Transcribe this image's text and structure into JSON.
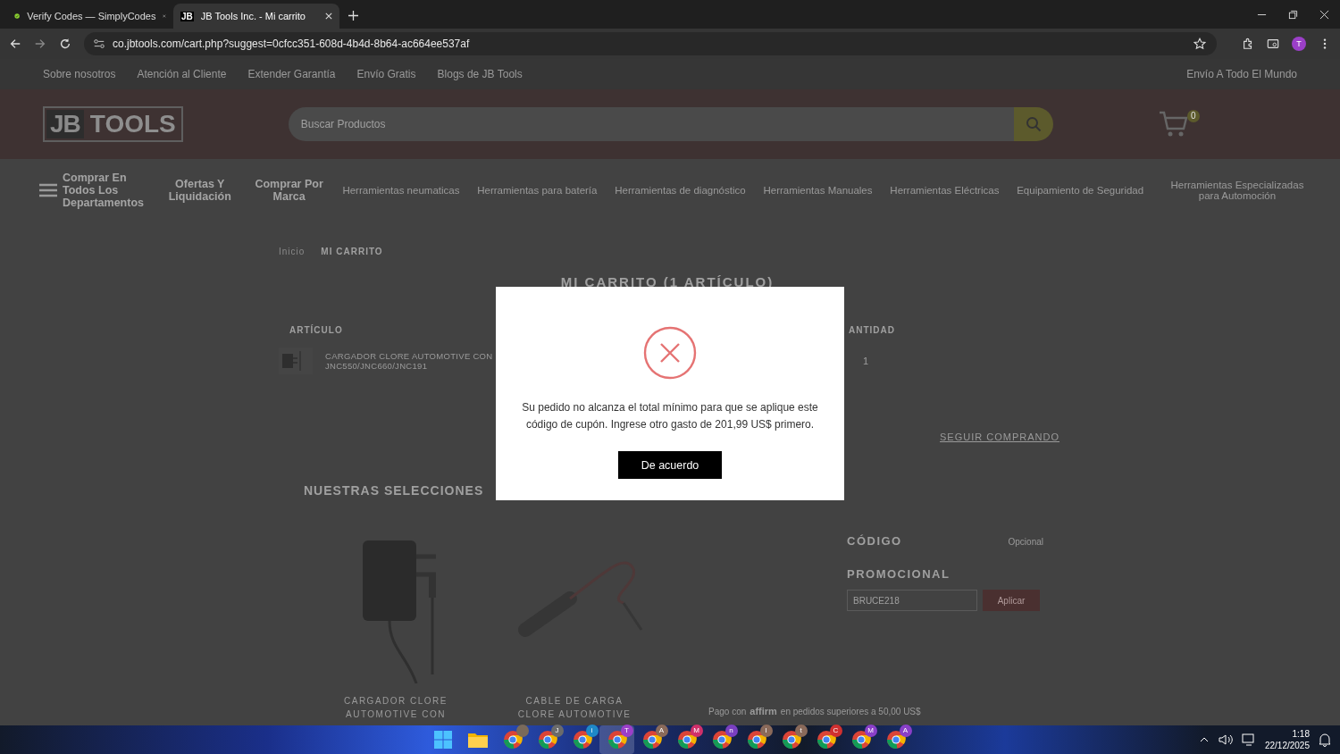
{
  "browser": {
    "tabs": [
      {
        "title": "Verify Codes — SimplyCodes",
        "selected": false,
        "kind": "check"
      },
      {
        "title": "JB Tools Inc. - Mi carrito",
        "selected": true,
        "kind": "text",
        "favicon": "JB"
      }
    ],
    "url": "co.jbtools.com/cart.php?suggest=0cfcc351-608d-4b4d-8b64-ac664ee537af",
    "profile": "T"
  },
  "site": {
    "top_links": [
      "Sobre nosotros",
      "Atención al Cliente",
      "Extender Garantía",
      "Envío Gratis",
      "Blogs de JB Tools"
    ],
    "top_right": "Envío A Todo El Mundo",
    "logo": {
      "left": "JB",
      "right": "TOOLS"
    },
    "search": {
      "placeholder": "Buscar Productos"
    },
    "cart_count": "0",
    "nav": [
      {
        "label": "Comprar En Todos Los Departamentos",
        "kind": "menu"
      },
      {
        "label": "Ofertas Y Liquidación",
        "kind": "bold"
      },
      {
        "label": "Comprar Por Marca",
        "kind": "bold"
      },
      {
        "label": "Herramientas neumaticas",
        "kind": "plain"
      },
      {
        "label": "Herramientas para batería",
        "kind": "plain"
      },
      {
        "label": "Herramientas de diagnóstico",
        "kind": "plain"
      },
      {
        "label": "Herramientas Manuales",
        "kind": "plain"
      },
      {
        "label": "Herramientas Eléctricas",
        "kind": "plain"
      },
      {
        "label": "Equipamiento de Seguridad",
        "kind": "plain"
      },
      {
        "label": "Herramientas Especializadas para Automoción",
        "kind": "plain"
      }
    ],
    "breadcrumb": [
      "Inicio",
      "MI CARRITO"
    ],
    "cart": {
      "title": "MI CARRITO (1 ARTÍCULO)",
      "columns": [
        "ARTÍCULO",
        "ANTIDAD"
      ],
      "item": {
        "name": [
          "CARGADOR CLORE AUTOMOTIVE CON",
          "JNC550/JNC660/JNC191"
        ],
        "quantity": "1"
      },
      "continue": "SEGUIR COMPRANDO"
    },
    "selections": {
      "title": "NUESTRAS SELECCIONES",
      "products": [
        {
          "name": [
            "CARGADOR CLORE",
            "AUTOMOTIVE CON"
          ],
          "kind": "charger"
        },
        {
          "name": [
            "CABLE DE CARGA",
            "CLORE AUTOMOTIVE"
          ],
          "kind": "cable"
        }
      ]
    },
    "promo": {
      "label": "CÓDIGO",
      "optional": "Opcional",
      "label2": "PROMOCIONAL",
      "value": "BRUCE218",
      "button": "Aplicar"
    },
    "affirm": {
      "prefix": "Pago con",
      "logo": "affirm",
      "suffix": "en pedidos superiores a 50,00 US$"
    }
  },
  "dialog": {
    "message": "Su pedido no alcanza el total mínimo para que se aplique este código de cupón. Ingrese otro gasto de 201,99 US$ primero.",
    "button": "De acuerdo"
  },
  "taskbar": {
    "apps": [
      {
        "kind": "start",
        "selected": false
      },
      {
        "kind": "folder",
        "selected": false
      },
      {
        "kind": "browser",
        "color": "#7a6a5a",
        "selected": false
      },
      {
        "kind": "browser",
        "badge": "J",
        "color": "#6b6b6b",
        "selected": false
      },
      {
        "kind": "browser",
        "badge": "i",
        "color": "#1e88c8",
        "selected": false
      },
      {
        "kind": "browser",
        "badge": "T",
        "color": "#9b3fc8",
        "selected": true
      },
      {
        "kind": "browser",
        "badge": "A",
        "color": "#8a6a5a",
        "selected": false
      },
      {
        "kind": "browser",
        "badge": "M",
        "color": "#d0306a",
        "selected": false
      },
      {
        "kind": "browser",
        "badge": "n",
        "color": "#7a3fc0",
        "selected": false
      },
      {
        "kind": "browser",
        "badge": "I",
        "color": "#8a6a5a",
        "selected": false
      },
      {
        "kind": "browser",
        "badge": "t",
        "color": "#8a6a5a",
        "selected": false
      },
      {
        "kind": "browser",
        "badge": "C",
        "color": "#d03030",
        "selected": false
      },
      {
        "kind": "browser",
        "badge": "M",
        "color": "#8a3fc8",
        "selected": false
      },
      {
        "kind": "browser",
        "badge": "A",
        "color": "#8a3fc8",
        "selected": false
      }
    ],
    "time": "1:18",
    "date": "22/12/2025"
  }
}
